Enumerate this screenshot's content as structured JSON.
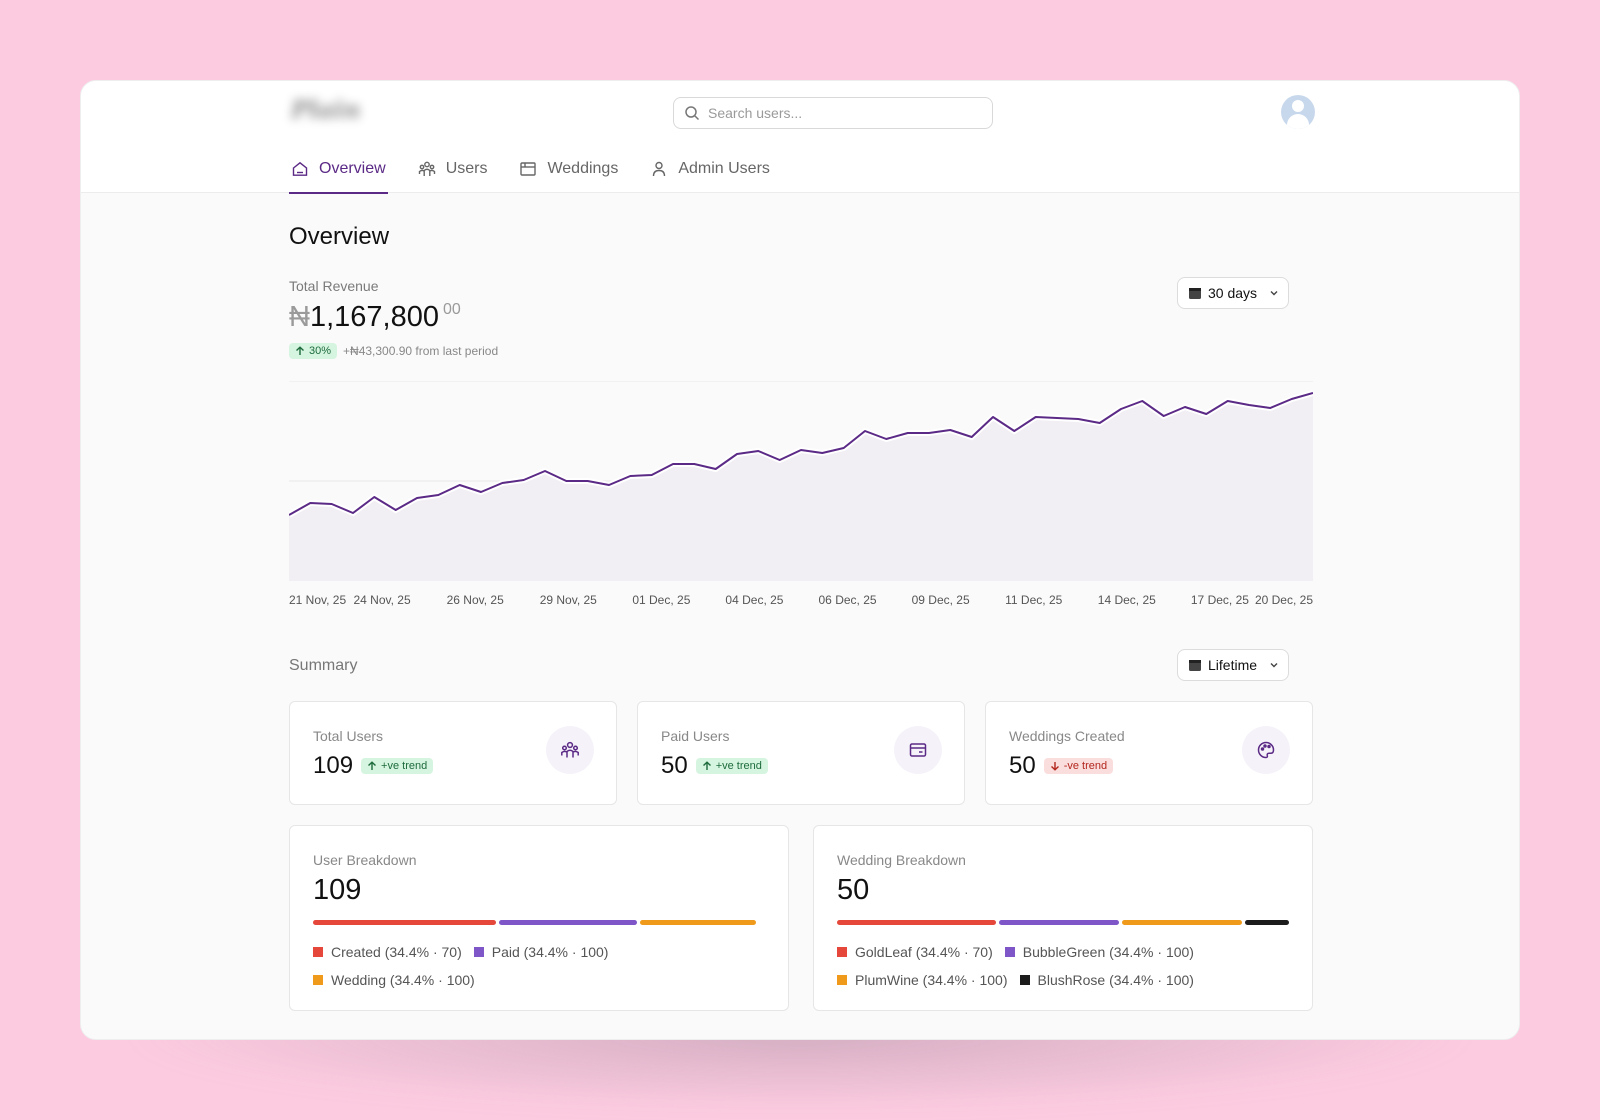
{
  "app": {
    "search_placeholder": "Search users..."
  },
  "nav": {
    "tabs": [
      {
        "label": "Overview",
        "icon": "home-icon",
        "active": true
      },
      {
        "label": "Users",
        "icon": "users-icon",
        "active": false
      },
      {
        "label": "Weddings",
        "icon": "calendar-icon",
        "active": false
      },
      {
        "label": "Admin Users",
        "icon": "user-icon",
        "active": false
      }
    ]
  },
  "page": {
    "title": "Overview"
  },
  "revenue": {
    "label": "Total Revenue",
    "currency": "₦",
    "amount": "1,167,800",
    "cents": "00",
    "change_badge": "30%",
    "change_text": "+₦43,300.90 from last period",
    "range_label": "30 days"
  },
  "chart_data": {
    "type": "area",
    "title": "",
    "xlabel": "",
    "ylabel": "",
    "color": "#5b2a86",
    "x_tick_labels": [
      "21 Nov, 25",
      "24 Nov, 25",
      "26 Nov, 25",
      "29 Nov, 25",
      "01 Dec, 25",
      "04 Dec, 25",
      "06 Dec, 25",
      "09 Dec, 25",
      "11 Dec, 25",
      "14 Dec, 25",
      "17 Dec, 25",
      "20 Dec, 25"
    ],
    "ylim": [
      0,
      200
    ],
    "gridlines": [
      100,
      200
    ],
    "values": [
      66,
      78,
      77,
      68,
      84,
      71,
      83,
      86,
      96,
      89,
      98,
      101,
      110,
      100,
      100,
      96,
      105,
      106,
      117,
      117,
      112,
      127,
      130,
      121,
      131,
      128,
      133,
      150,
      142,
      148,
      148,
      151,
      144,
      164,
      150,
      164,
      163,
      162,
      158,
      172,
      180,
      165,
      174,
      167,
      180,
      176,
      173,
      182,
      188
    ]
  },
  "summary": {
    "label": "Summary",
    "range_label": "Lifetime",
    "cards": [
      {
        "label": "Total Users",
        "value": "109",
        "trend": "+ve trend",
        "direction": "up",
        "icon": "users-icon"
      },
      {
        "label": "Paid Users",
        "value": "50",
        "trend": "+ve trend",
        "direction": "up",
        "icon": "wallet-icon"
      },
      {
        "label": "Weddings Created",
        "value": "50",
        "trend": "-ve trend",
        "direction": "down",
        "icon": "palette-icon"
      }
    ]
  },
  "user_breakdown": {
    "label": "User Breakdown",
    "total": "109",
    "segments": [
      {
        "label": "Created (34.4% · 70)",
        "color": "#e5483b",
        "share": 0.41
      },
      {
        "label": "Paid (34.4% · 100)",
        "color": "#7e56c8",
        "share": 0.31
      },
      {
        "label": "Wedding (34.4% · 100)",
        "color": "#ef9a1a",
        "share": 0.26
      }
    ]
  },
  "wedding_breakdown": {
    "label": "Wedding Breakdown",
    "total": "50",
    "segments": [
      {
        "label": "GoldLeaf (34.4% · 70)",
        "color": "#e5483b",
        "share": 0.36
      },
      {
        "label": "BubbleGreen (34.4% · 100)",
        "color": "#7e56c8",
        "share": 0.27
      },
      {
        "label": "PlumWine (34.4% · 100)",
        "color": "#ef9a1a",
        "share": 0.27
      },
      {
        "label": "BlushRose (34.4% · 100)",
        "color": "#1c1c1c",
        "share": 0.1
      }
    ]
  }
}
